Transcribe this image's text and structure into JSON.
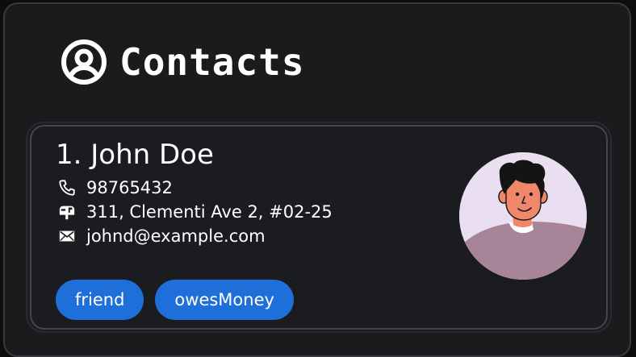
{
  "header": {
    "title": "Contacts",
    "icon": "user-circle-icon"
  },
  "contact": {
    "index_name": "1. John Doe",
    "phone": "98765432",
    "address": "311, Clementi Ave 2, #02-25",
    "email": "johnd@example.com",
    "tags": [
      "friend",
      "owesMoney"
    ],
    "avatar": "person-avatar"
  },
  "colors": {
    "background": "#1b1b1d",
    "card": "#1b1c20",
    "tag": "#1e6fd9",
    "avatar_bg": "#e9dff0"
  }
}
